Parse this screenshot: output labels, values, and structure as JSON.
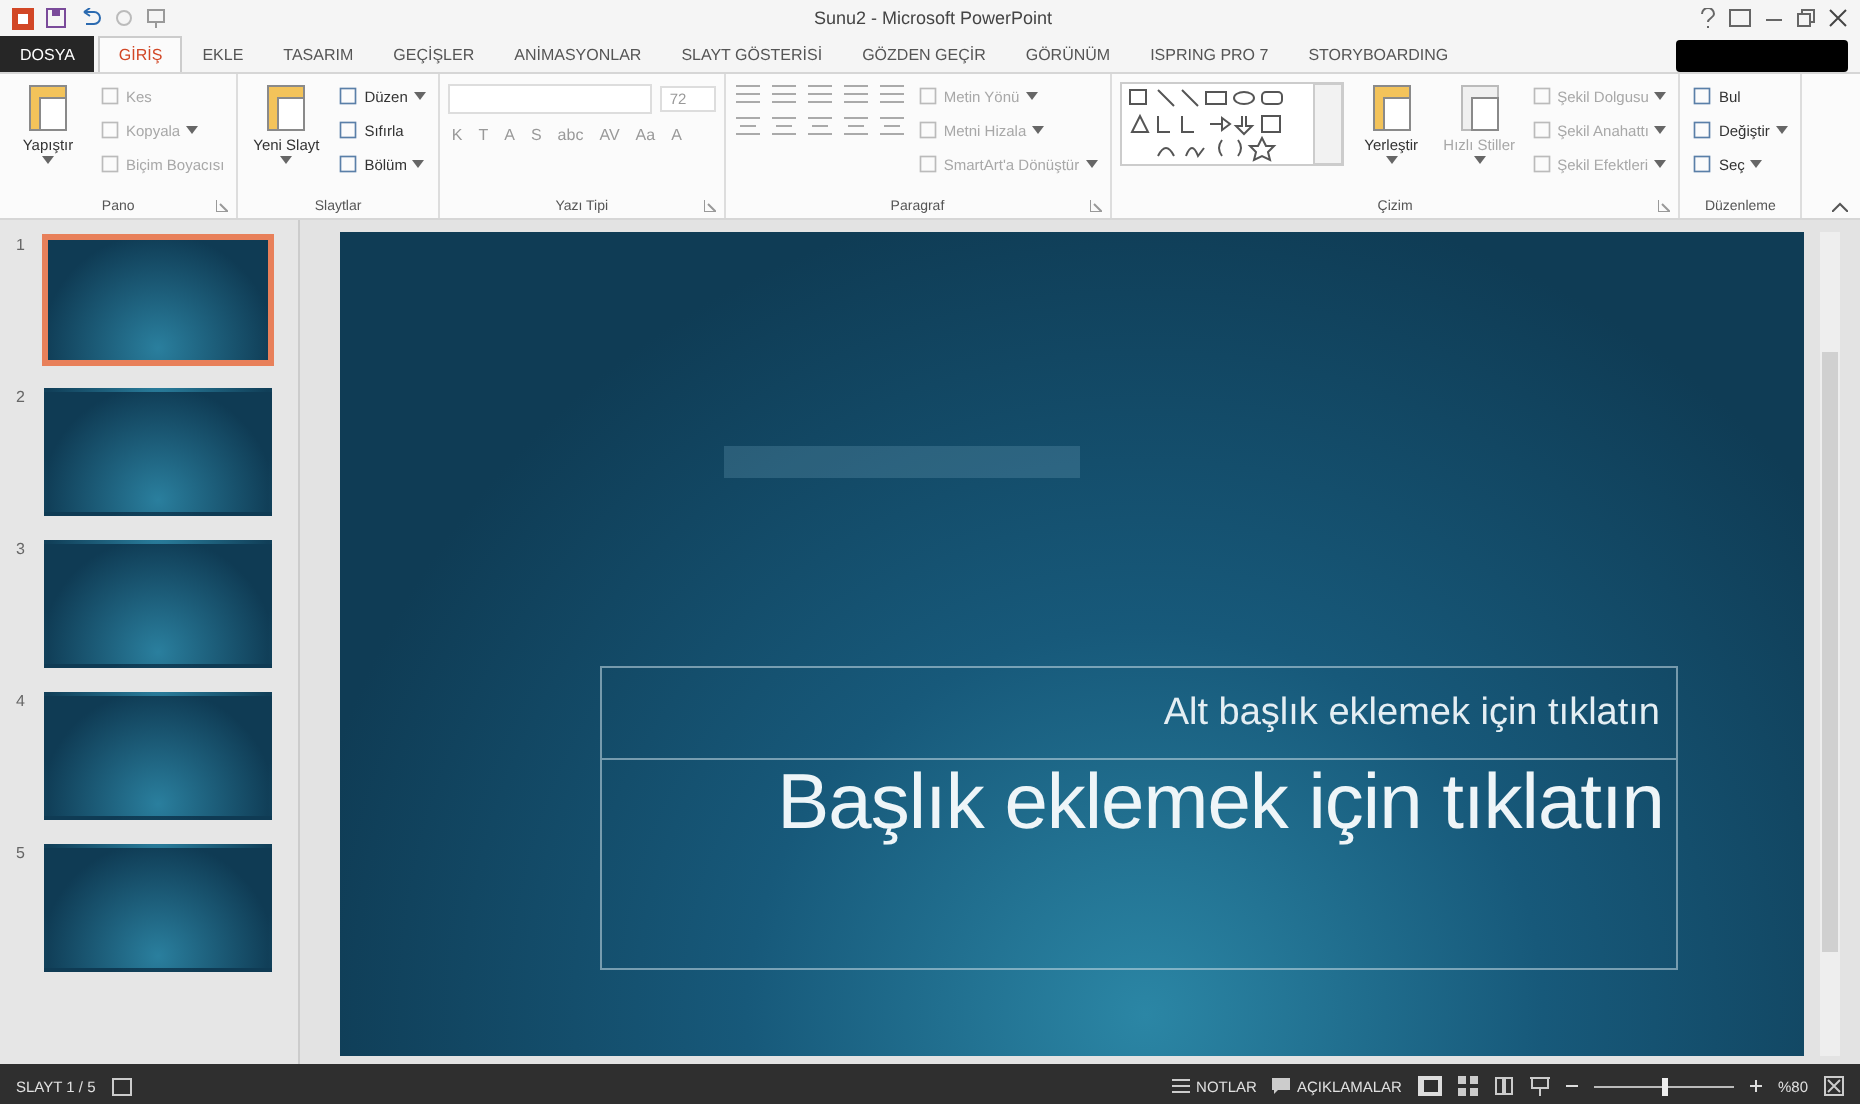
{
  "window": {
    "title": "Sunu2 - Microsoft PowerPoint"
  },
  "tabs": [
    {
      "label": "DOSYA",
      "kind": "file",
      "selected": false
    },
    {
      "label": "GİRİŞ",
      "kind": "tab",
      "selected": true
    },
    {
      "label": "EKLE",
      "kind": "tab",
      "selected": false
    },
    {
      "label": "TASARIM",
      "kind": "tab",
      "selected": false
    },
    {
      "label": "GEÇİŞLER",
      "kind": "tab",
      "selected": false
    },
    {
      "label": "ANİMASYONLAR",
      "kind": "tab",
      "selected": false
    },
    {
      "label": "SLAYT GÖSTERİSİ",
      "kind": "tab",
      "selected": false
    },
    {
      "label": "GÖZDEN GEÇİR",
      "kind": "tab",
      "selected": false
    },
    {
      "label": "GÖRÜNÜM",
      "kind": "tab",
      "selected": false
    },
    {
      "label": "ISPRING PRO 7",
      "kind": "tab",
      "selected": false
    },
    {
      "label": "STORYBOARDING",
      "kind": "tab",
      "selected": false
    }
  ],
  "ribbon": [
    {
      "name": "Pano",
      "launcher": true,
      "items": [
        {
          "kind": "large",
          "label": "Yapıştır",
          "menu": true,
          "disabled": false
        },
        {
          "kind": "small",
          "label": "Kes",
          "menu": false,
          "disabled": true
        },
        {
          "kind": "small",
          "label": "Kopyala",
          "menu": true,
          "disabled": true
        },
        {
          "kind": "small",
          "label": "Biçim Boyacısı",
          "menu": false,
          "disabled": true
        }
      ]
    },
    {
      "name": "Slaytlar",
      "launcher": false,
      "items": [
        {
          "kind": "large",
          "label": "Yeni Slayt",
          "menu": true,
          "disabled": false
        },
        {
          "kind": "small",
          "label": "Düzen",
          "menu": true,
          "disabled": false
        },
        {
          "kind": "small",
          "label": "Sıfırla",
          "menu": false,
          "disabled": false
        },
        {
          "kind": "small",
          "label": "Bölüm",
          "menu": true,
          "disabled": false
        }
      ]
    },
    {
      "name": "Yazı Tipi",
      "launcher": true,
      "items": [
        {
          "kind": "font",
          "size": "72",
          "format_buttons": [
            "K",
            "T",
            "A",
            "S",
            "abc",
            "AV",
            "Aa",
            "A"
          ]
        }
      ]
    },
    {
      "name": "Paragraf",
      "launcher": true,
      "items": [
        {
          "kind": "paragraph"
        },
        {
          "kind": "small",
          "label": "Metin Yönü",
          "menu": true,
          "disabled": true
        },
        {
          "kind": "small",
          "label": "Metni Hizala",
          "menu": true,
          "disabled": true
        },
        {
          "kind": "small",
          "label": "SmartArt'a Dönüştür",
          "menu": true,
          "disabled": true
        }
      ]
    },
    {
      "name": "Çizim",
      "launcher": true,
      "items": [
        {
          "kind": "gallery"
        },
        {
          "kind": "large",
          "label": "Yerleştir",
          "menu": true,
          "disabled": false
        },
        {
          "kind": "large",
          "label": "Hızlı Stiller",
          "menu": true,
          "disabled": true
        },
        {
          "kind": "small",
          "label": "Şekil Dolgusu",
          "menu": true,
          "disabled": true
        },
        {
          "kind": "small",
          "label": "Şekil Anahattı",
          "menu": true,
          "disabled": true
        },
        {
          "kind": "small",
          "label": "Şekil Efektleri",
          "menu": true,
          "disabled": true
        }
      ]
    },
    {
      "name": "Düzenleme",
      "launcher": false,
      "items": [
        {
          "kind": "small",
          "label": "Bul",
          "menu": false,
          "disabled": false
        },
        {
          "kind": "small",
          "label": "Değiştir",
          "menu": true,
          "disabled": false
        },
        {
          "kind": "small",
          "label": "Seç",
          "menu": true,
          "disabled": false
        }
      ]
    }
  ],
  "thumbnails": [
    {
      "number": "1",
      "selected": true
    },
    {
      "number": "2",
      "selected": false
    },
    {
      "number": "3",
      "selected": false
    },
    {
      "number": "4",
      "selected": false
    },
    {
      "number": "5",
      "selected": false
    }
  ],
  "slide": {
    "subtitle": "Alt başlık eklemek için tıklatın",
    "title": "Başlık eklemek için tıklatın"
  },
  "status_bar": {
    "slide": "SLAYT 1 / 5",
    "notes": "NOTLAR",
    "comments": "AÇIKLAMALAR",
    "zoom": {
      "level": 0.5,
      "reading": "%80"
    }
  }
}
